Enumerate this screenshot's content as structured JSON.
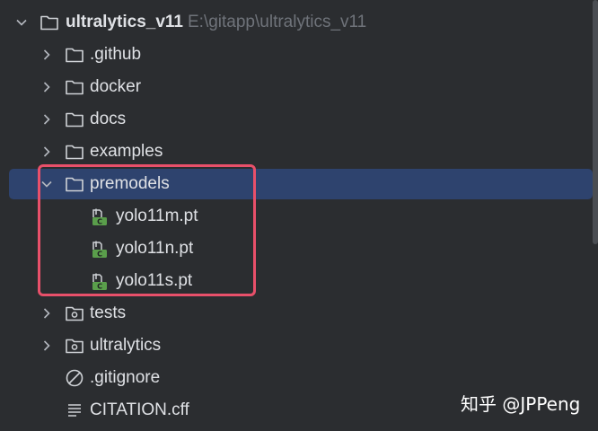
{
  "project": {
    "root_name": "ultralytics_v11",
    "root_path": "E:\\gitapp\\ultralytics_v11"
  },
  "tree": [
    {
      "label": ".github",
      "kind": "folder",
      "expanded": false
    },
    {
      "label": "docker",
      "kind": "folder",
      "expanded": false
    },
    {
      "label": "docs",
      "kind": "folder",
      "expanded": false
    },
    {
      "label": "examples",
      "kind": "folder",
      "expanded": false
    },
    {
      "label": "premodels",
      "kind": "folder",
      "expanded": true,
      "selected": true
    },
    {
      "label": "yolo11m.pt",
      "kind": "pt-file"
    },
    {
      "label": "yolo11n.pt",
      "kind": "pt-file"
    },
    {
      "label": "yolo11s.pt",
      "kind": "pt-file"
    },
    {
      "label": "tests",
      "kind": "package-folder",
      "expanded": false
    },
    {
      "label": "ultralytics",
      "kind": "package-folder",
      "expanded": false
    },
    {
      "label": ".gitignore",
      "kind": "ignore-file"
    },
    {
      "label": "CITATION.cff",
      "kind": "text-file"
    }
  ],
  "watermark": "知乎 @JPPeng",
  "colors": {
    "background": "#2b2d30",
    "selection": "#2e436e",
    "highlight_border": "#e8506a",
    "pt_file_icon": "#5a9e4b"
  }
}
